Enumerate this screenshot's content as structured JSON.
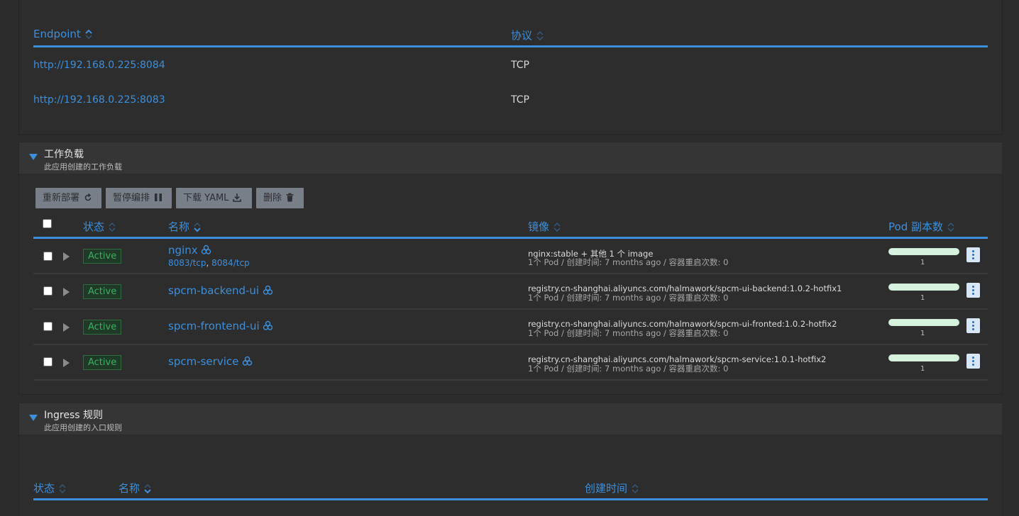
{
  "endpoints": {
    "headers": {
      "endpoint": "Endpoint",
      "protocol": "协议"
    },
    "rows": [
      {
        "url": "http://192.168.0.225:8084",
        "protocol": "TCP"
      },
      {
        "url": "http://192.168.0.225:8083",
        "protocol": "TCP"
      }
    ]
  },
  "workloads": {
    "title": "工作负载",
    "subtitle": "此应用创建的工作负载",
    "toolbar": {
      "redeploy": "重新部署",
      "pause": "暂停编排",
      "download": "下载 YAML",
      "delete": "删除"
    },
    "headers": {
      "status": "状态",
      "name": "名称",
      "image": "镜像",
      "pods": "Pod 副本数"
    },
    "rows": [
      {
        "status": "Active",
        "name": "nginx",
        "port1": "8083/tcp",
        "port2": "8084/tcp",
        "image": "nginx:stable + 其他 1 个 image",
        "meta": "1个 Pod / 创建时间: 7 months ago / 容器重启次数: 0",
        "replicas": "1"
      },
      {
        "status": "Active",
        "name": "spcm-backend-ui",
        "image": "registry.cn-shanghai.aliyuncs.com/halmawork/spcm-ui-backend:1.0.2-hotfix1",
        "meta": "1个 Pod / 创建时间: 7 months ago / 容器重启次数: 0",
        "replicas": "1"
      },
      {
        "status": "Active",
        "name": "spcm-frontend-ui",
        "image": "registry.cn-shanghai.aliyuncs.com/halmawork/spcm-ui-fronted:1.0.2-hotfix2",
        "meta": "1个 Pod / 创建时间: 7 months ago / 容器重启次数: 0",
        "replicas": "1"
      },
      {
        "status": "Active",
        "name": "spcm-service",
        "image": "registry.cn-shanghai.aliyuncs.com/halmawork/spcm-service:1.0.1-hotfix2",
        "meta": "1个 Pod / 创建时间: 7 months ago / 容器重启次数: 0",
        "replicas": "1"
      }
    ]
  },
  "ingress": {
    "title": "Ingress 规则",
    "subtitle": "此应用创建的入口规则",
    "headers": {
      "status": "状态",
      "name": "名称",
      "created": "创建时间"
    }
  },
  "colors": {
    "accent": "#3d8fdb",
    "active": "#3bb061",
    "background": "#2c2c2c"
  }
}
